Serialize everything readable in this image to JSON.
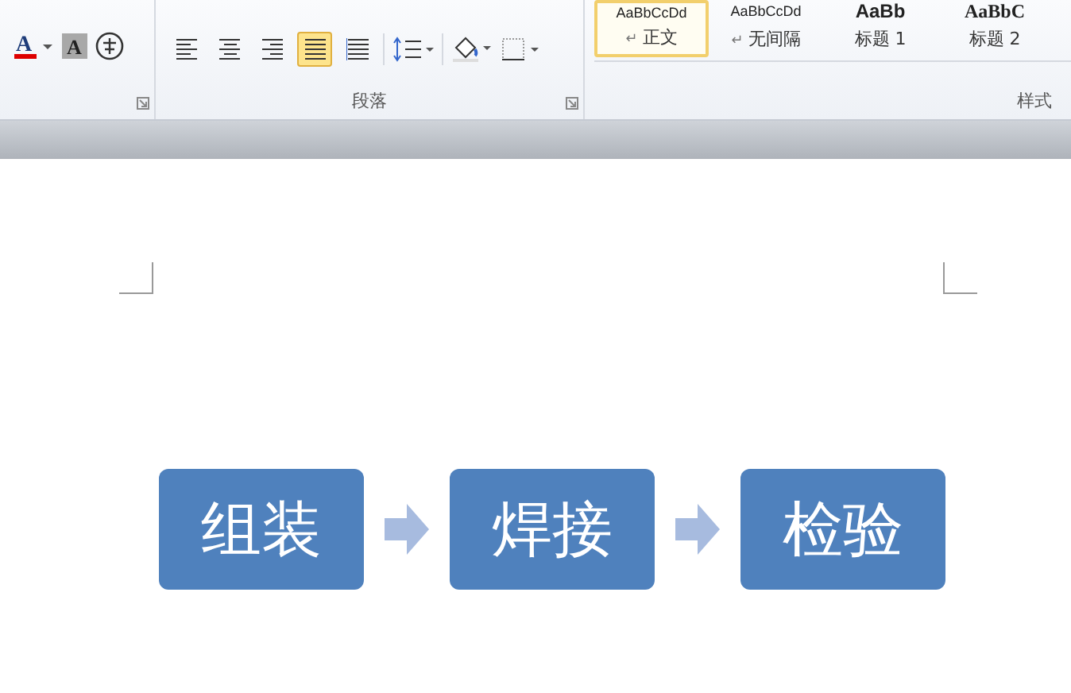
{
  "ribbon": {
    "font_group": {
      "tools": [
        {
          "kind": "font-color",
          "glyph": "A"
        },
        {
          "kind": "char-shading",
          "glyph": "A"
        },
        {
          "kind": "enclose"
        }
      ]
    },
    "paragraph_group": {
      "label": "段落",
      "align_buttons": [
        {
          "kind": "left",
          "selected": false
        },
        {
          "kind": "center",
          "selected": false
        },
        {
          "kind": "right",
          "selected": false
        },
        {
          "kind": "justify",
          "selected": true
        },
        {
          "kind": "distributed",
          "selected": false
        }
      ]
    },
    "styles_group": {
      "label": "样式",
      "styles": [
        {
          "preview": "AaBbCcDd",
          "name": "正文",
          "paragraph_mark": "↵",
          "selected": true,
          "kind": "normal"
        },
        {
          "preview": "AaBbCcDd",
          "name": "无间隔",
          "paragraph_mark": "↵",
          "selected": false,
          "kind": "normal"
        },
        {
          "preview": "AaBb",
          "name": "标题 1",
          "selected": false,
          "kind": "heading"
        },
        {
          "preview": "AaBbC",
          "name": "标题 2",
          "selected": false,
          "kind": "heading2"
        }
      ]
    }
  },
  "diagram": {
    "steps": [
      "组装",
      "焊接",
      "检验"
    ]
  }
}
